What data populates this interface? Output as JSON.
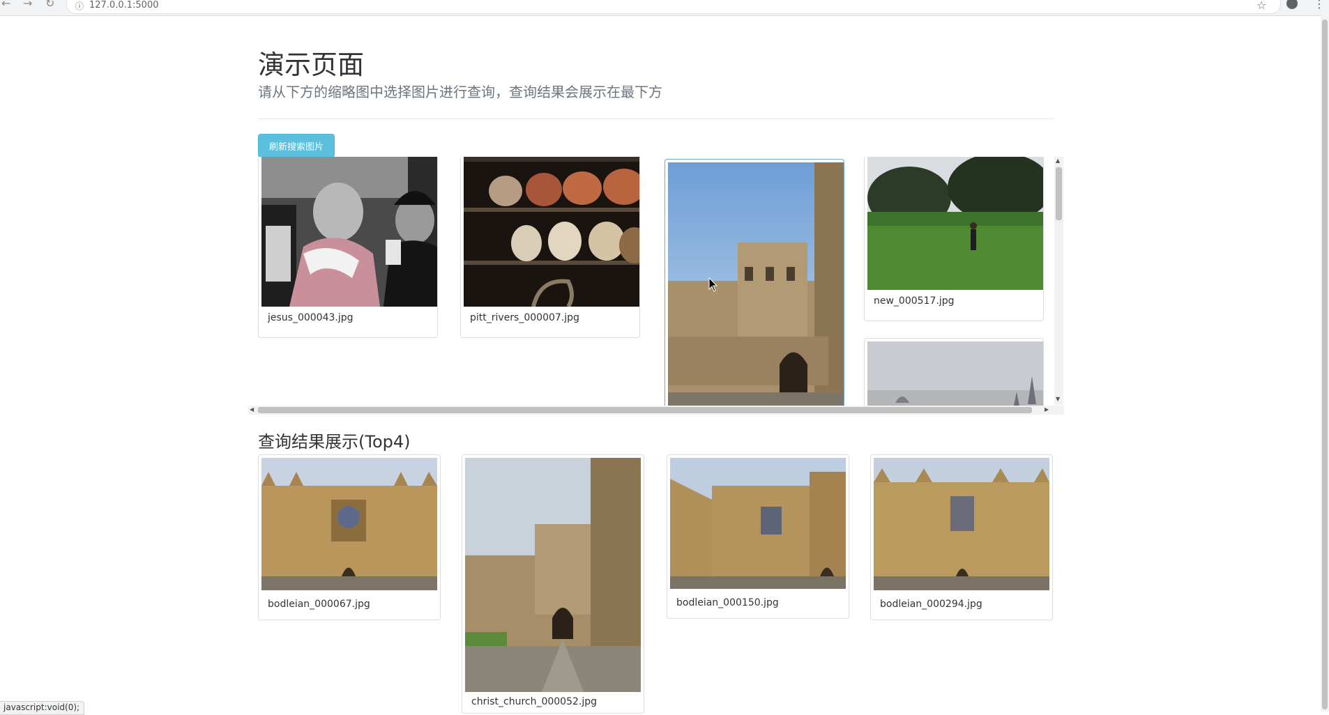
{
  "browser": {
    "url": "127.0.0.1:5000",
    "back_icon": "←",
    "forward_icon": "→",
    "reload_icon": "↻",
    "info_icon": "ⓘ",
    "star_icon": "☆",
    "menu_icon": "⋮"
  },
  "header": {
    "title": "演示页面",
    "subtitle": "请从下方的缩略图中选择图片进行查询，查询结果会展示在最下方"
  },
  "toolbar": {
    "refresh_label": "刷新搜索图片",
    "accent_color": "#5bc0de"
  },
  "gallery": {
    "items": [
      {
        "filename": "jesus_000043.jpg",
        "selected": false
      },
      {
        "filename": "pitt_rivers_000007.jpg",
        "selected": false
      },
      {
        "filename": "",
        "selected": true
      },
      {
        "filename": "new_000517.jpg",
        "selected": false
      },
      {
        "filename": "",
        "selected": false
      }
    ]
  },
  "results": {
    "title": "查询结果展示(Top4)",
    "items": [
      {
        "filename": "bodleian_000067.jpg"
      },
      {
        "filename": "christ_church_000052.jpg"
      },
      {
        "filename": "bodleian_000150.jpg"
      },
      {
        "filename": "bodleian_000294.jpg"
      }
    ]
  },
  "status_bar": {
    "text": "javascript:void(0);"
  }
}
